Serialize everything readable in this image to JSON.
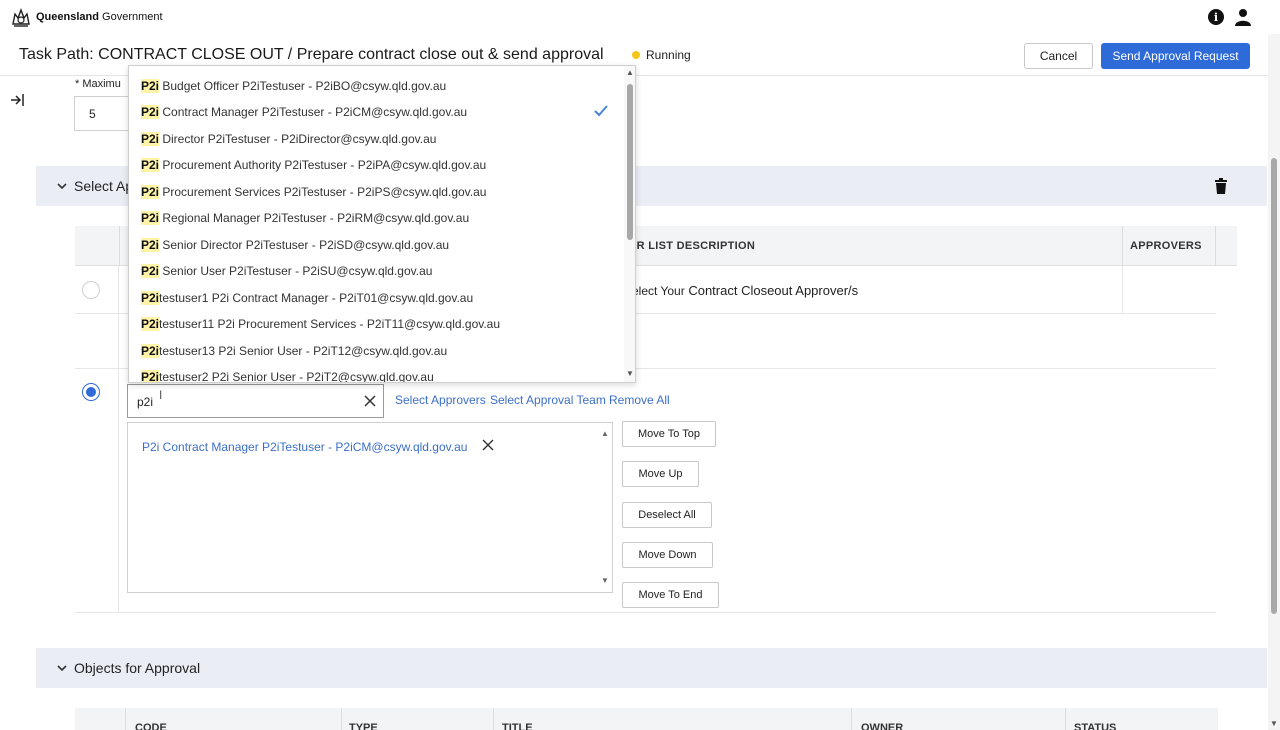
{
  "header": {
    "gov_name_bold": "Queensland",
    "gov_name_rest": " Government"
  },
  "task": {
    "title": "Task Path: CONTRACT CLOSE OUT / Prepare contract close out & send approval",
    "status": "Running",
    "cancel_label": "Cancel",
    "send_label": "Send Approval Request"
  },
  "form": {
    "max_label": "* Maximu",
    "max_value": "5"
  },
  "section1": {
    "title": "Select Ap"
  },
  "table": {
    "col_desc": "ER LIST DESCRIPTION",
    "col_approvers": "APPROVERS",
    "row1_prefix": "elect Your",
    "row1_text": " Contract Closeout Approver/s"
  },
  "search": {
    "value": "p2i",
    "select_approvers": "Select Approvers",
    "select_team": "Select Approval Team",
    "remove_all": "Remove All"
  },
  "selected": {
    "item": "P2i Contract Manager P2iTestuser - P2iCM@csyw.qld.gov.au"
  },
  "side_buttons": {
    "top": "Move To Top",
    "up": "Move Up",
    "deselect": "Deselect All",
    "down": "Move Down",
    "end": "Move To End"
  },
  "dropdown": {
    "items": [
      {
        "hl": "P2i",
        "rest": " Budget Officer P2iTestuser - ",
        "email": " P2iBO@csyw.qld.gov.au"
      },
      {
        "hl": "P2i",
        "rest": " Contract Manager P2iTestuser - ",
        "email": " P2iCM@csyw.qld.gov.au"
      },
      {
        "hl": "P2i",
        "rest": " Director P2iTestuser - ",
        "email": " P2iDirector@csyw.qld.gov.au"
      },
      {
        "hl": "P2i",
        "rest": " Procurement Authority P2iTestuser - ",
        "email": " P2iPA@csyw.qld.gov.au"
      },
      {
        "hl": "P2i",
        "rest": " Procurement Services P2iTestuser - ",
        "email": " P2iPS@csyw.qld.gov.au"
      },
      {
        "hl": "P2i",
        "rest": " Regional Manager P2iTestuser - ",
        "email": " P2iRM@csyw.qld.gov.au"
      },
      {
        "hl": "P2i",
        "rest": " Senior Director P2iTestuser - ",
        "email": "  P2iSD@csyw.qld.gov.au"
      },
      {
        "hl": "P2i",
        "rest": " Senior User P2iTestuser - ",
        "email": " P2iSU@csyw.qld.gov.au"
      },
      {
        "hl": "P2i",
        "rest": "testuser1 P2i Contract Manager - ",
        "email": "P2iT01@csyw.qld.gov.au"
      },
      {
        "hl": "P2i",
        "rest": "testuser11 P2i Procurement Services - ",
        "email": "P2iT11@csyw.qld.gov.au"
      },
      {
        "hl": "P2i",
        "rest": "testuser13 P2i Senior User - ",
        "email": " P2iT12@csyw.qld.gov.au"
      },
      {
        "hl": "P2i",
        "rest": "testuser2 P2i Senior User - ",
        "email": " P2iT2@csyw.qld.gov.au"
      }
    ]
  },
  "section2": {
    "title": "Objects for Approval"
  },
  "objects_table": {
    "code": "CODE",
    "type": "TYPE",
    "title": "TITLE",
    "owner": "OWNER",
    "status": "STATUS"
  },
  "colors": {
    "accent": "#2f6bd8",
    "link": "#3d6fc9",
    "highlight": "#fff3a8",
    "running": "#f5c518",
    "band": "#ebedf5"
  }
}
